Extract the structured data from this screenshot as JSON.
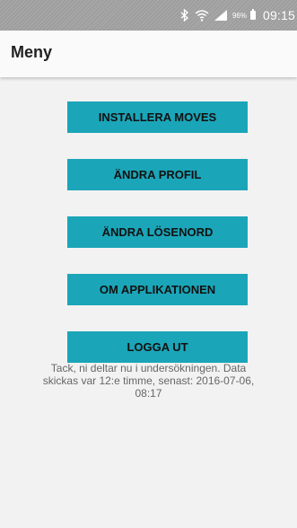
{
  "status_bar": {
    "bluetooth_icon": "bluetooth-icon",
    "wifi_icon": "wifi-icon",
    "signal_icon": "signal-icon",
    "battery_percent": "96%",
    "time": "09:15"
  },
  "appbar": {
    "title": "Meny"
  },
  "menu": {
    "buttons": [
      {
        "label": "INSTALLERA MOVES"
      },
      {
        "label": "ÄNDRA PROFIL"
      },
      {
        "label": "ÄNDRA LÖSENORD"
      },
      {
        "label": "OM APPLIKATIONEN"
      },
      {
        "label": "LOGGA UT"
      }
    ]
  },
  "info_text": "Tack, ni deltar nu i undersökningen. Data skickas var 12:e timme, senast: 2016-07-06, 08:17",
  "colors": {
    "accent": "#1ba5b8",
    "background": "#f2f2f2",
    "status_bar": "#a0a0a0"
  }
}
